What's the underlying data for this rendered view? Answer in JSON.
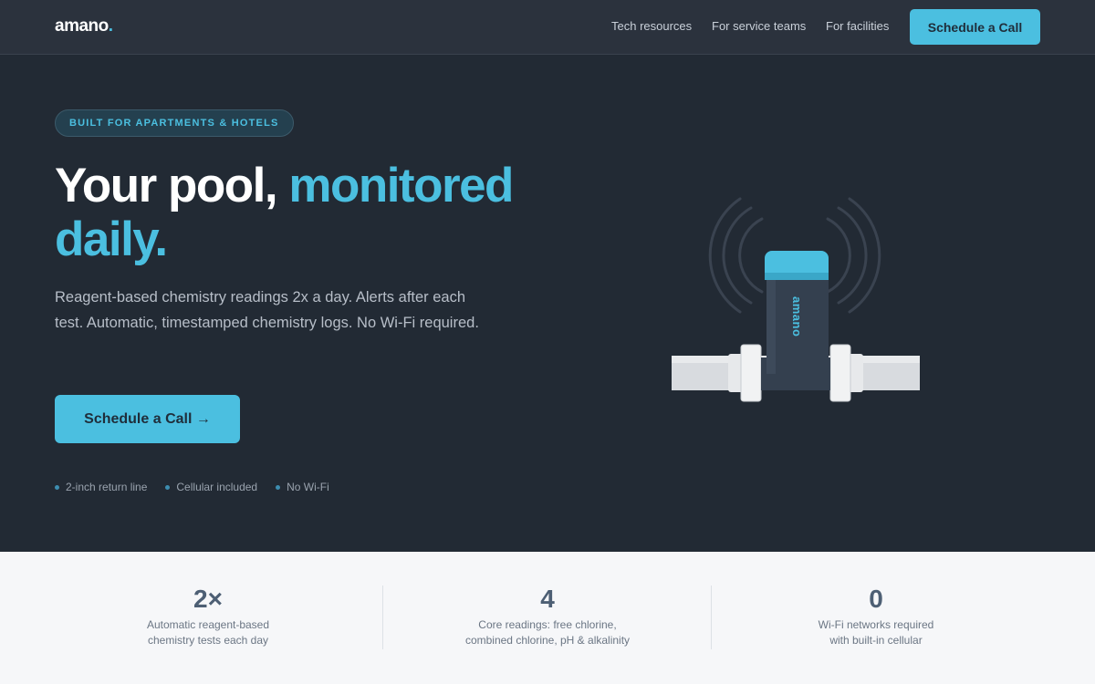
{
  "nav": {
    "logo_text": "amano",
    "logo_dot": ".",
    "links": [
      "Tech resources",
      "For service teams",
      "For facilities"
    ],
    "cta_label": "Schedule a Call"
  },
  "hero": {
    "badge": "BUILT FOR APARTMENTS & HOTELS",
    "headline_plain": "Your pool, ",
    "headline_accent": "monitored daily.",
    "subcopy": "Reagent-based chemistry readings 2x a day. Alerts after each test. Automatic, timestamped chemistry logs. No Wi-Fi required.",
    "cta_label": "Schedule a Call →",
    "features": [
      "2-inch return line",
      "Cellular included",
      "No Wi-Fi"
    ]
  },
  "device": {
    "brand_text": "amano"
  },
  "stats": [
    {
      "value": "2×",
      "label": "Automatic reagent-based\nchemistry tests each day"
    },
    {
      "value": "4",
      "label": "Core readings: free chlorine,\ncombined chlorine, pH & alkalinity"
    },
    {
      "value": "0",
      "label": "Wi-Fi networks required\nwith built-in cellular"
    }
  ],
  "colors": {
    "accent": "#4bbfe0",
    "background": "#222a34",
    "nav_background": "#2b323d",
    "stats_background": "#f6f7f9"
  }
}
